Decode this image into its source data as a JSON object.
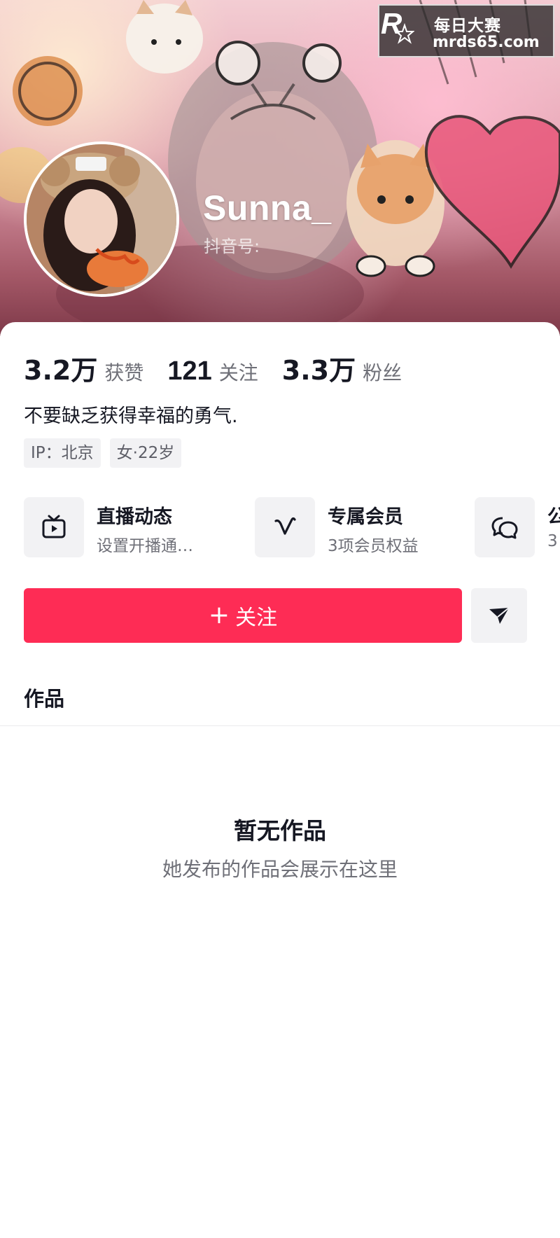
{
  "watermark": {
    "cn_text": "每日大赛",
    "url": "mrds65.com"
  },
  "profile": {
    "username": "Sunna_",
    "douyin_id_label": "抖音号:"
  },
  "stats": [
    {
      "value": "3.2万",
      "label": "获赞"
    },
    {
      "value": "121",
      "label": "关注"
    },
    {
      "value": "3.3万",
      "label": "粉丝"
    }
  ],
  "bio": "不要缺乏获得幸福的勇气.",
  "tags": [
    "IP：北京",
    "女·22岁"
  ],
  "features": [
    {
      "title": "直播动态",
      "subtitle": "设置开播通…",
      "icon": "tv-icon"
    },
    {
      "title": "专属会员",
      "subtitle": "3项会员权益",
      "icon": "v-icon"
    },
    {
      "title": "公",
      "subtitle": "3",
      "icon": "chat-bubbles-icon"
    }
  ],
  "actions": {
    "follow_label": "关注",
    "share_icon": "send-icon"
  },
  "tabs": {
    "works": "作品"
  },
  "empty_state": {
    "title": "暂无作品",
    "subtitle": "她发布的作品会展示在这里"
  },
  "colors": {
    "accent": "#fe2c55",
    "text_primary": "#161823",
    "text_secondary": "#6f7078",
    "chip_bg": "#f2f2f4"
  }
}
